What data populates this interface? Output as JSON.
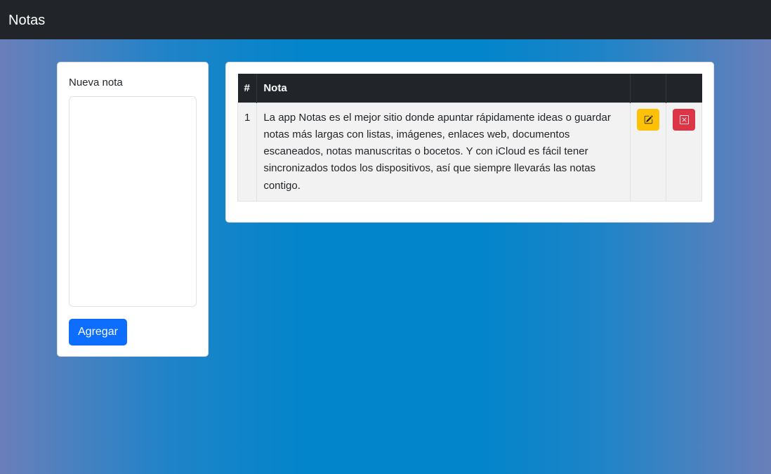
{
  "navbar": {
    "brand": "Notas"
  },
  "new_note": {
    "label": "Nueva nota",
    "textarea_value": "",
    "add_button": "Agregar"
  },
  "table": {
    "headers": [
      "#",
      "Nota",
      "",
      ""
    ],
    "rows": [
      {
        "num": "1",
        "text": "La app Notas es el mejor sitio donde apuntar rápidamente ideas o guardar notas más largas con listas, imágenes, enlaces web, documentos escaneados, notas manuscritas o bocetos. Y con iCloud es fácil tener sincronizados todos los dispositivos, así que siempre llevarás las notas contigo.",
        "edit_icon": "pencil-square-icon",
        "delete_icon": "x-square-icon"
      }
    ]
  },
  "colors": {
    "navbar_bg": "#212529",
    "primary": "#0d6efd",
    "warning": "#ffc107",
    "danger": "#dc3545",
    "background_center": "#0285cb",
    "background_edge": "#6a7fba"
  }
}
